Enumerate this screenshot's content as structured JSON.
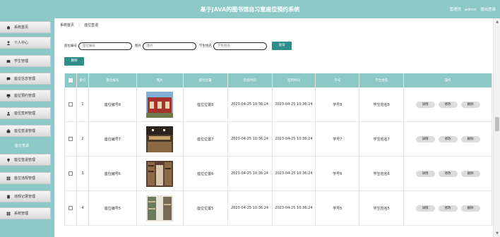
{
  "header": {
    "title": "基于JAVA的图书馆自习室座位预约系统",
    "user_role_label": "管理员",
    "username": "admin",
    "logout_label": "退出登录"
  },
  "sidebar": {
    "items": [
      {
        "label": "系统首页",
        "icon": "home-icon"
      },
      {
        "label": "个人中心",
        "icon": "user-icon"
      },
      {
        "label": "学生管理",
        "icon": "users-icon"
      },
      {
        "label": "座位信息管理",
        "icon": "chat-icon"
      },
      {
        "label": "座位预约管理",
        "icon": "monitor-icon"
      },
      {
        "label": "座位签到管理",
        "icon": "person-icon"
      },
      {
        "label": "座位签退管理",
        "icon": "briefcase-icon"
      },
      {
        "label": "座位签退管理",
        "icon": "bulb-icon"
      },
      {
        "label": "座位违规管理",
        "icon": "grid-icon"
      },
      {
        "label": "违规记录管理",
        "icon": "doc-icon"
      },
      {
        "label": "系统管理",
        "icon": "grid-icon"
      }
    ],
    "active_sub": "座位签退"
  },
  "breadcrumb": {
    "home": "系统首页",
    "separator": "⋮",
    "current": "座位签退"
  },
  "search": {
    "seat_no_label": "座位编号",
    "seat_no_placeholder": "座位编号",
    "image_label": "图片",
    "image_placeholder": "图片",
    "student_name_label": "学生姓名",
    "student_name_placeholder": "学生姓名",
    "search_button": "查询"
  },
  "delete_button": "删除",
  "table": {
    "headers": [
      "",
      "索引",
      "座位编号",
      "图片",
      "座位位置",
      "签退时间",
      "签到时间",
      "学号",
      "学生姓名",
      "操作"
    ],
    "rows": [
      {
        "index": "1",
        "seat_no": "座位编号8",
        "location": "座位位置8",
        "time1": "2023-04-25 10:36:24",
        "time2": "2023-04-25 10:36:24",
        "student_id": "学号8",
        "student_name": "学生姓名8",
        "img": "library-exterior"
      },
      {
        "index": "2",
        "seat_no": "座位编号7",
        "location": "座位位置7",
        "time1": "2023-04-25 10:36:24",
        "time2": "2023-04-25 10:36:24",
        "student_id": "学号7",
        "student_name": "学生姓名7",
        "img": "library-room"
      },
      {
        "index": "3",
        "seat_no": "座位编号6",
        "location": "座位位置6",
        "time1": "2023-04-25 10:36:24",
        "time2": "2023-04-25 10:36:24",
        "student_id": "学号6",
        "student_name": "学生姓名6",
        "img": "bookshelves"
      },
      {
        "index": "4",
        "seat_no": "座位编号5",
        "location": "座位位置5",
        "time1": "2023-04-25 10:36:24",
        "time2": "2023-04-25 10:36:24",
        "student_id": "学号5",
        "student_name": "学生姓名5",
        "img": "bookshelf-aisle"
      }
    ],
    "actions": [
      "详情",
      "修改",
      "删除"
    ]
  },
  "colors": {
    "accent": "#8cc9c6",
    "button": "#2f8e8a"
  }
}
